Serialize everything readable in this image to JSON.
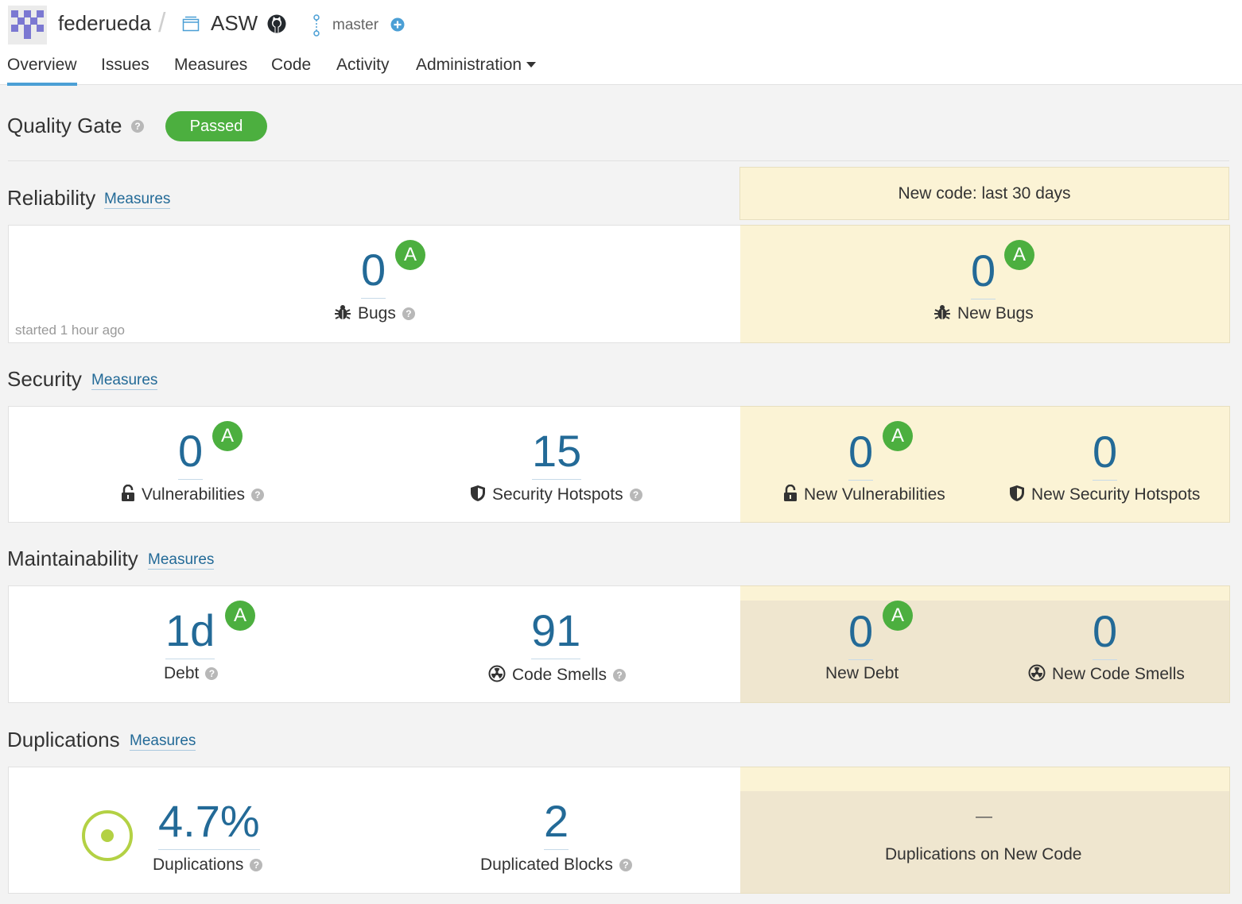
{
  "header": {
    "org": "federueda",
    "project": "ASW",
    "branch": "master"
  },
  "nav": {
    "tabs": [
      "Overview",
      "Issues",
      "Measures",
      "Code",
      "Activity",
      "Administration"
    ]
  },
  "quality_gate": {
    "title": "Quality Gate",
    "status": "Passed",
    "status_color": "#4caf3f"
  },
  "new_code": {
    "label": "New code: last 30 days"
  },
  "measures_link": "Measures",
  "reliability": {
    "title": "Reliability",
    "bugs": {
      "value": "0",
      "rating": "A",
      "label": "Bugs"
    },
    "analysis_time": "started 1 hour ago",
    "new_bugs": {
      "value": "0",
      "rating": "A",
      "label": "New Bugs"
    }
  },
  "security": {
    "title": "Security",
    "vulnerabilities": {
      "value": "0",
      "rating": "A",
      "label": "Vulnerabilities"
    },
    "hotspots": {
      "value": "15",
      "label": "Security Hotspots"
    },
    "new_vulnerabilities": {
      "value": "0",
      "rating": "A",
      "label": "New Vulnerabilities"
    },
    "new_hotspots": {
      "value": "0",
      "label": "New Security Hotspots"
    }
  },
  "maintainability": {
    "title": "Maintainability",
    "debt": {
      "value": "1d",
      "rating": "A",
      "label": "Debt"
    },
    "code_smells": {
      "value": "91",
      "label": "Code Smells"
    },
    "new_debt": {
      "value": "0",
      "rating": "A",
      "label": "New Debt"
    },
    "new_code_smells": {
      "value": "0",
      "label": "New Code Smells"
    }
  },
  "duplications": {
    "title": "Duplications",
    "density": {
      "value": "4.7%",
      "label": "Duplications"
    },
    "blocks": {
      "value": "2",
      "label": "Duplicated Blocks"
    },
    "new_code": {
      "value": "—",
      "label": "Duplications on New Code"
    }
  },
  "colors": {
    "link": "#236a97",
    "rating_a": "#4caf3f",
    "leak_bg": "#fbf3d5",
    "nav_active": "#4b9fd5",
    "duplication_donut": "#b3d144"
  },
  "icons": [
    "avatar",
    "project-icon",
    "github-icon",
    "branch-icon",
    "add-branch-icon",
    "help-icon",
    "bug-icon",
    "lock-icon",
    "shield-icon",
    "code-smell-icon",
    "duplications-donut-icon"
  ]
}
